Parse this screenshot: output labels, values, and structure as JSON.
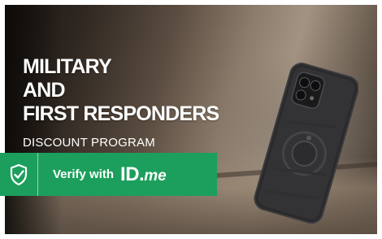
{
  "promo": {
    "headline_lines": [
      "MILITARY",
      "AND",
      "FIRST RESPONDERS"
    ],
    "subheadline": "DISCOUNT PROGRAM"
  },
  "verify_button": {
    "label": "Verify with",
    "logo_id": "ID",
    "logo_dot": ".",
    "logo_me": "me",
    "icon": "shield-check-icon",
    "color": "#1c9f5d"
  },
  "product_image": {
    "icon": "phone-case-image"
  }
}
